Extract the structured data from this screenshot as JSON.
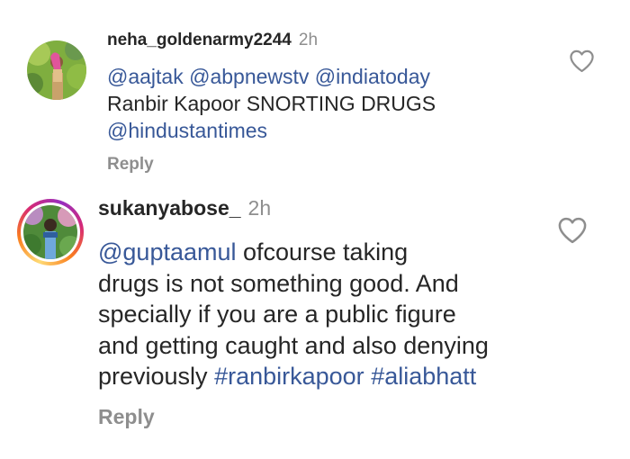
{
  "comments": [
    {
      "username": "neha_goldenarmy2244",
      "time": "2h",
      "lines": [
        [
          {
            "t": "@aajtak @abpnewstv @indiatoday",
            "m": true
          }
        ],
        [
          {
            "t": "Ranbir Kapoor SNORTING DRUGS",
            "m": false
          }
        ],
        [
          {
            "t": "@hindustantimes",
            "m": true
          }
        ]
      ],
      "reply_label": "Reply",
      "like_icon": "heart-outline-icon",
      "has_story_ring": false
    },
    {
      "username": "sukanyabose_",
      "time": "2h",
      "lines": [
        [
          {
            "t": "@guptaamul",
            "m": true
          },
          {
            "t": " ofcourse taking",
            "m": false
          }
        ],
        [
          {
            "t": "drugs is not something good. And",
            "m": false
          }
        ],
        [
          {
            "t": "specially if you are a public figure",
            "m": false
          }
        ],
        [
          {
            "t": "and getting caught and also denying",
            "m": false
          }
        ],
        [
          {
            "t": "previously ",
            "m": false
          },
          {
            "t": "#ranbirkapoor",
            "m": true
          },
          {
            "t": " ",
            "m": false
          },
          {
            "t": "#aliabhatt",
            "m": true
          }
        ]
      ],
      "reply_label": "Reply",
      "like_icon": "heart-outline-icon",
      "has_story_ring": true
    }
  ],
  "colors": {
    "text": "#262626",
    "secondary": "#8e8e8e",
    "link": "#385898",
    "background": "#ffffff"
  }
}
